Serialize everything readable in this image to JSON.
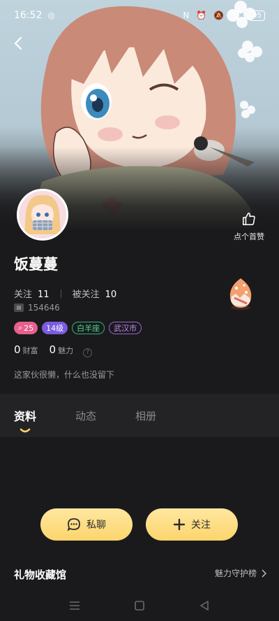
{
  "status_bar": {
    "time": "16:52",
    "icons": [
      "nfc-icon",
      "alarm-icon",
      "mute-icon",
      "wifi-icon",
      "battery-icon"
    ],
    "battery": "95"
  },
  "profile": {
    "nickname": "饭蔓蔓",
    "like_label": "点个首赞",
    "following_label": "关注",
    "following_count": "11",
    "followers_label": "被关注",
    "followers_count": "10",
    "user_id": "154646",
    "tags": {
      "level": "25",
      "vip": "14级",
      "zodiac": "白羊座",
      "city": "武汉市"
    },
    "wealth_value": "0",
    "wealth_label": "财富",
    "charm_value": "0",
    "charm_label": "魅力",
    "bio": "这家伙很懒，什么也没留下"
  },
  "tabs": [
    {
      "label": "资料"
    },
    {
      "label": "动态"
    },
    {
      "label": "相册"
    }
  ],
  "actions": {
    "chat_label": "私聊",
    "follow_label": "关注"
  },
  "gift_section": {
    "title": "礼物收藏馆",
    "link_label": "魅力守护榜"
  },
  "colors": {
    "accent_yellow": "#fcd56c",
    "level_pink": "#e85f8e",
    "vip_purple": "#7b5ce0",
    "zodiac_green": "#33b07a",
    "city_purple": "#9b63d9"
  }
}
